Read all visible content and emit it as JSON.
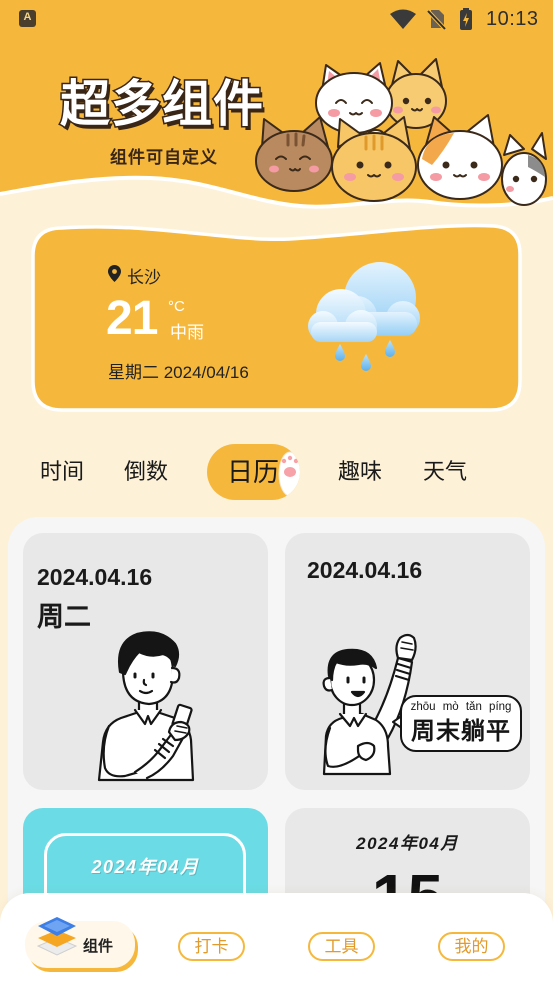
{
  "status_bar": {
    "notification_glyph": "A",
    "time": "10:13",
    "icons": [
      "wifi-icon",
      "no-sim-icon",
      "battery-charging-icon"
    ]
  },
  "banner": {
    "title": "超多组件",
    "subtitle": "组件可自定义"
  },
  "weather": {
    "city": "长沙",
    "temperature": "21",
    "unit": "°C",
    "condition": "中雨",
    "date_line": "星期二 2024/04/16",
    "icon": "cloud-rain-icon"
  },
  "tabs": [
    {
      "label": "时间",
      "selected": false
    },
    {
      "label": "倒数",
      "selected": false
    },
    {
      "label": "日历",
      "selected": true
    },
    {
      "label": "趣味",
      "selected": false
    },
    {
      "label": "天气",
      "selected": false
    }
  ],
  "widgets": [
    {
      "date": "2024.04.16",
      "weekday": "周二"
    },
    {
      "date": "2024.04.16",
      "bubble_pinyin": "zhōu mò tǎn píng",
      "bubble_text": "周末躺平"
    },
    {
      "month": "2024年04月"
    },
    {
      "month": "2024年04月",
      "day": "15"
    }
  ],
  "bottom_nav": [
    {
      "label": "组件",
      "selected": true,
      "icon": "layers-icon"
    },
    {
      "label": "打卡",
      "selected": false
    },
    {
      "label": "工具",
      "selected": false
    },
    {
      "label": "我的",
      "selected": false
    }
  ],
  "colors": {
    "accent": "#F5B83D",
    "background": "#FDF1D8",
    "card": "#E8E8E8",
    "cyan_card": "#6BDCE5",
    "panel": "#F6F6F6",
    "nav_text": "#E19B2C"
  }
}
